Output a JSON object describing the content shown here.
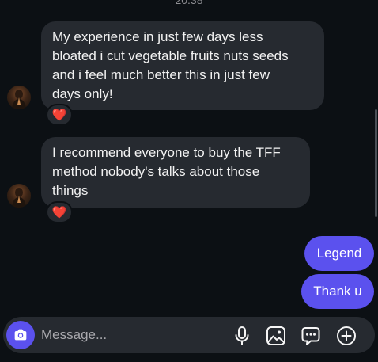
{
  "thread": {
    "timestamp": "20:38",
    "messages": [
      {
        "direction": "incoming",
        "text": "My experience in just few days less bloated i cut vegetable fruits nuts seeds and i feel much better this in just few days only!",
        "lines": [
          "My experience in just few days less",
          "bloated i cut vegetable fruits nuts seeds",
          "and i feel much better this in just few",
          "days only!"
        ],
        "reaction": "❤️"
      },
      {
        "direction": "incoming",
        "text": "I recommend everyone to buy the TFF method nobody's talks about those things",
        "lines": [
          "I recommend everyone to buy the TFF",
          "method nobody's talks about those",
          "things"
        ],
        "reaction": "❤️"
      },
      {
        "direction": "outgoing",
        "text": "Legend"
      },
      {
        "direction": "outgoing",
        "text": "Thank u"
      }
    ]
  },
  "composer": {
    "placeholder": "Message...",
    "icons": [
      "camera-icon",
      "microphone-icon",
      "gallery-icon",
      "sticker-icon",
      "plus-circle-icon"
    ]
  },
  "colors": {
    "background": "#0c1014",
    "incoming_bubble": "#262a30",
    "outgoing_bubble": "#5b51ee",
    "heart": "#ff3040"
  }
}
